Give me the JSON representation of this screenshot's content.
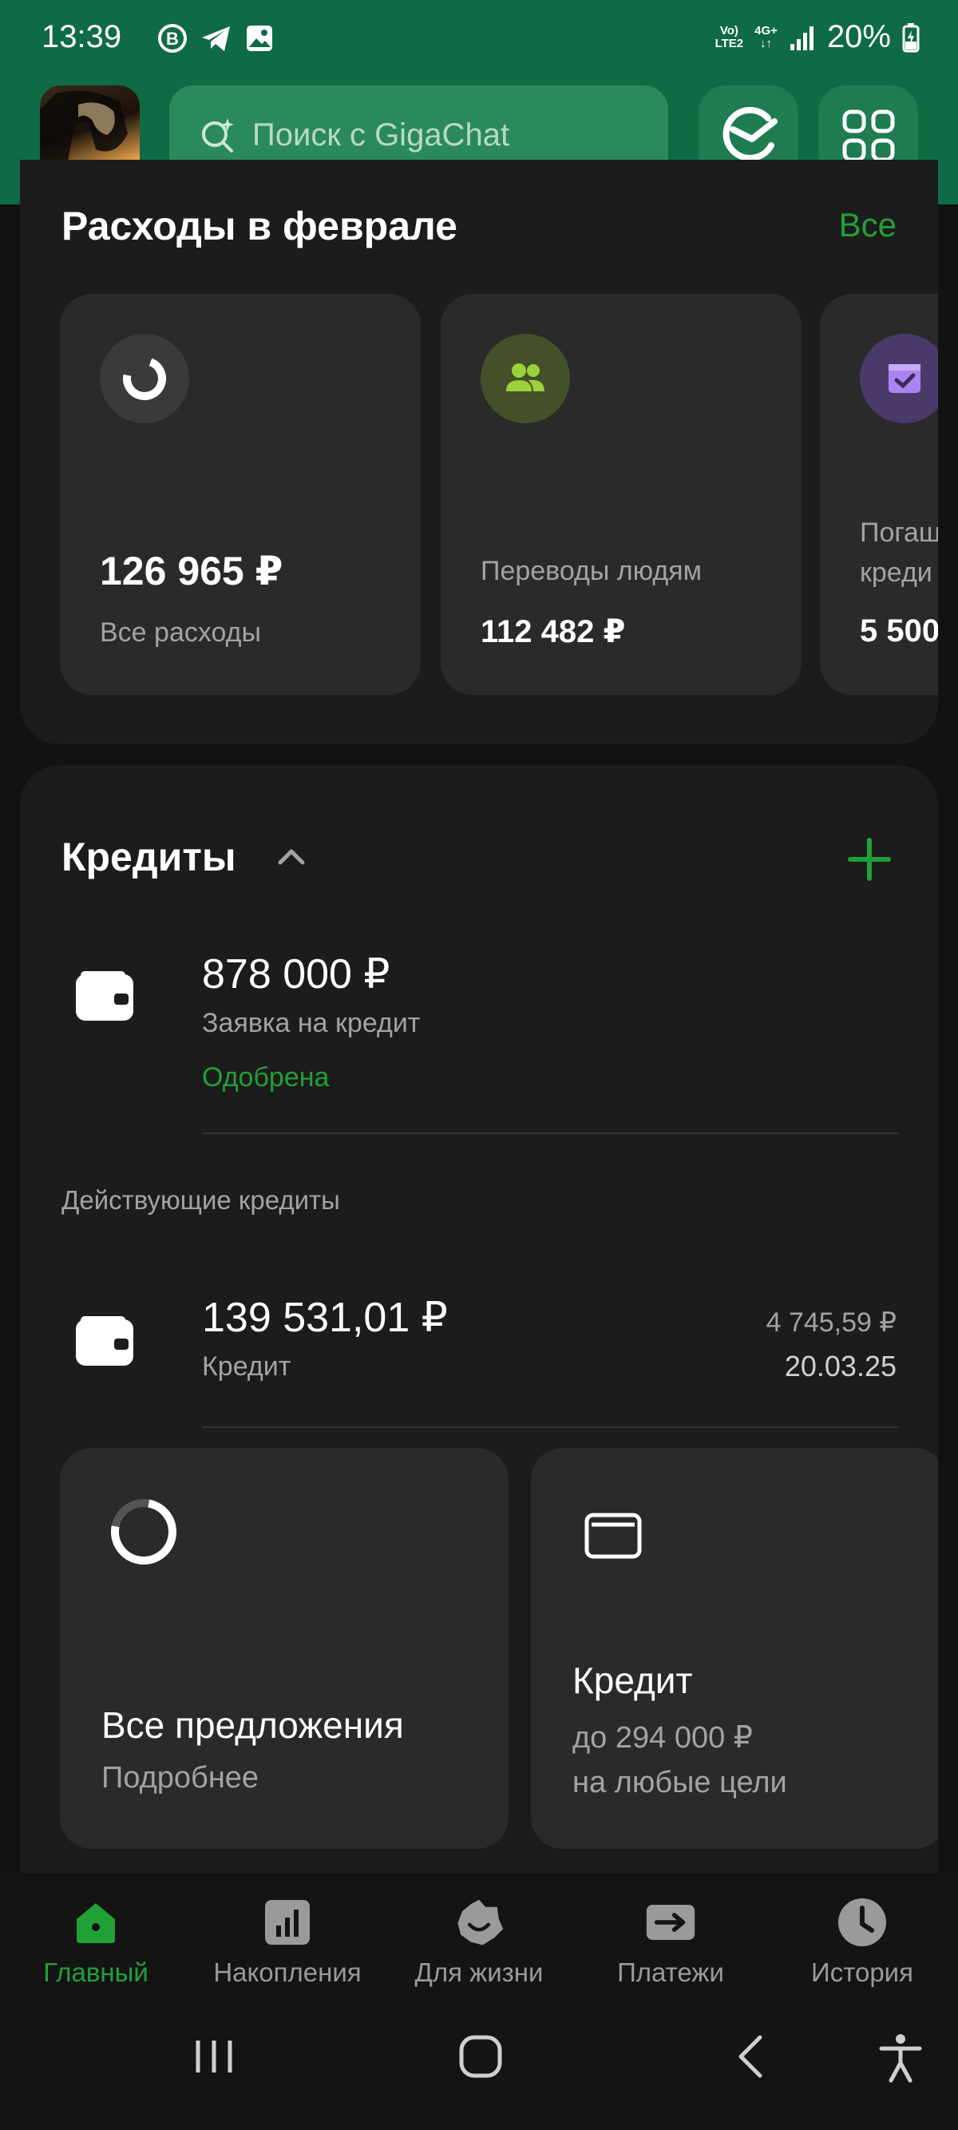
{
  "status_bar": {
    "time": "13:39",
    "net_top": "Vo)",
    "net_bottom": "LTE2",
    "gen_top": "4G+",
    "gen_bottom": "↓↑",
    "battery": "20%"
  },
  "header": {
    "search_placeholder": "Поиск с GigaChat"
  },
  "expenses": {
    "title": "Расходы в феврале",
    "all_link": "Все",
    "tiles": [
      {
        "amount": "126 965 ₽",
        "label": "Все расходы"
      },
      {
        "label": "Переводы людям",
        "amount": "112 482 ₽"
      },
      {
        "label_line1": "Погаш",
        "label_line2": "креди",
        "amount": "5 500"
      }
    ]
  },
  "credits": {
    "title": "Кредиты",
    "application": {
      "amount": "878 000 ₽",
      "label": "Заявка на кредит",
      "status": "Одобрена"
    },
    "active_header": "Действующие кредиты",
    "active": [
      {
        "amount": "139 531,01 ₽",
        "label": "Кредит",
        "payment": "4 745,59 ₽",
        "date": "20.03.25"
      }
    ],
    "offers": [
      {
        "title": "Все предложения",
        "subtitle": "Подробнее"
      },
      {
        "title": "Кредит",
        "line1": "до 294 000 ₽",
        "line2": "на любые цели"
      }
    ]
  },
  "bottom_nav": {
    "items": [
      {
        "label": "Главный",
        "icon": "home-icon",
        "active": true
      },
      {
        "label": "Накопления",
        "icon": "chart-icon",
        "active": false
      },
      {
        "label": "Для жизни",
        "icon": "smile-icon",
        "active": false
      },
      {
        "label": "Платежи",
        "icon": "arrow-right-icon",
        "active": false
      },
      {
        "label": "История",
        "icon": "clock-icon",
        "active": false
      }
    ]
  },
  "colors": {
    "brand_green": "#21a038",
    "header_bg": "#0f6a46",
    "card_bg": "#1c1c1c",
    "tile_bg": "#2a2a2a"
  }
}
